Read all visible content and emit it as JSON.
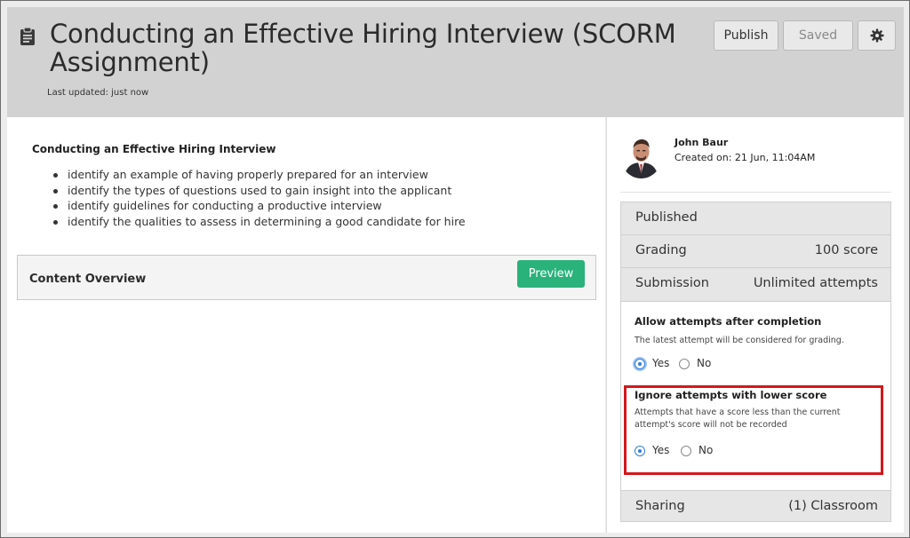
{
  "header": {
    "title": "Conducting an Effective Hiring Interview (SCORM Assignment)",
    "last_updated": "Last updated: just now",
    "icon": "clipboard-icon",
    "buttons": {
      "publish": "Publish",
      "saved": "Saved",
      "settings_icon": "gear-icon"
    }
  },
  "main": {
    "content_title": "Conducting an Effective Hiring Interview",
    "objectives": [
      "identify an example of having properly prepared for an interview",
      "identify the types of questions used to gain insight into the applicant",
      "identify guidelines for conducting a productive interview",
      "identify the qualities to assess in determining a good candidate for hire"
    ],
    "overview_label": "Content Overview",
    "preview_label": "Preview"
  },
  "sidebar": {
    "author": {
      "name": "John Baur",
      "created": "Created on: 21 Jun, 11:04AM"
    },
    "status": "Published",
    "grading": {
      "label": "Grading",
      "value": "100 score"
    },
    "submission": {
      "label": "Submission",
      "value": "Unlimited attempts"
    },
    "allow_attempts": {
      "title": "Allow attempts after completion",
      "desc": "The latest attempt will be considered for grading.",
      "yes": "Yes",
      "no": "No",
      "selected": "Yes"
    },
    "ignore_lower": {
      "title": "Ignore attempts with lower score",
      "desc": "Attempts that have a score less than the current attempt's score will not be recorded",
      "yes": "Yes",
      "no": "No",
      "selected": "Yes"
    },
    "sharing": {
      "label": "Sharing",
      "value": "(1) Classroom"
    }
  },
  "colors": {
    "accent_green": "#2ab27b",
    "radio_blue": "#2f7de1",
    "highlight_red": "#d3181c",
    "header_gray": "#d2d2d2"
  }
}
